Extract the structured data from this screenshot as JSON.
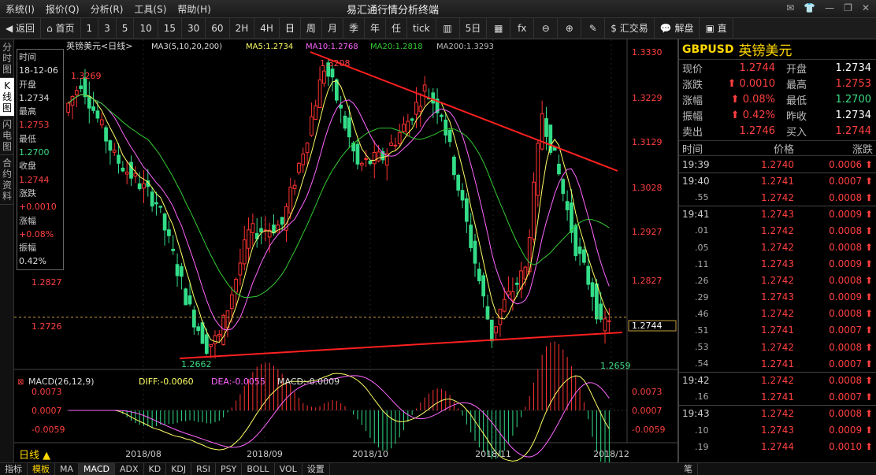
{
  "menu": {
    "items": [
      "系统(I)",
      "报价(Q)",
      "分析(R)",
      "工具(S)",
      "帮助(H)"
    ],
    "title": "易汇通行情分析终端"
  },
  "toolbar": {
    "back": "返回",
    "home": "首页",
    "periods": [
      "1",
      "3",
      "5",
      "10",
      "15",
      "30",
      "60",
      "2H",
      "4H",
      "日",
      "周",
      "月",
      "季",
      "年",
      "任",
      "tick"
    ],
    "five_day": "5日",
    "fx": "fx",
    "trade": "汇交易",
    "unlock": "解盘",
    "last": "直"
  },
  "leftnav": [
    "分时图",
    "K线图",
    "闪电图",
    "合约资料"
  ],
  "chart": {
    "symbol_label": "英镑美元<日线>",
    "ma_label": "MA3(5,10,20,200)",
    "ma5": "MA5:1.2734",
    "ma10": "MA10:1.2768",
    "ma20": "MA20:1.2818",
    "ma200": "MA200:1.3293",
    "price_ticks": [
      "1.3330",
      "1.3229",
      "1.3129",
      "1.3028",
      "1.2927",
      "1.2827",
      "1.2726"
    ],
    "left_ticks": [
      "1.2827",
      "1.2726"
    ],
    "current_price": "1.2744",
    "annotations": {
      "high1": "1.3269",
      "high2": "1.3208",
      "low1": "1.2662",
      "low2": "1.2659"
    },
    "dates": [
      "2018/08",
      "2018/09",
      "2018/10",
      "2018/11",
      "2018/12"
    ],
    "macd_label": "MACD(26,12,9)",
    "diff": "DIFF:-0.0060",
    "dea": "DEA:-0.0055",
    "macd": "MACD:-0.0009",
    "macd_ticks": [
      "0.0073",
      "0.0007",
      "-0.0059"
    ],
    "period_name": "日线"
  },
  "infobox": {
    "time_label": "时间",
    "time": "18-12-06",
    "open_label": "开盘",
    "open": "1.2734",
    "high_label": "最高",
    "high": "1.2753",
    "low_label": "最低",
    "low": "1.2700",
    "close_label": "收盘",
    "close": "1.2744",
    "chg_label": "涨跌",
    "chg": "+0.0010",
    "pct_label": "涨幅",
    "pct": "+0.08%",
    "amp_label": "振幅",
    "amp": "0.42%"
  },
  "quote": {
    "code": "GBPUSD",
    "name": "英镑美元",
    "rows": [
      {
        "l": "现价",
        "v": "1.2744",
        "l2": "开盘",
        "v2": "1.2734",
        "c2": "#ffffff"
      },
      {
        "l": "涨跌",
        "v": "0.0010",
        "l2": "最高",
        "v2": "1.2753",
        "c2": "#ff4040"
      },
      {
        "l": "涨幅",
        "v": "0.08%",
        "l2": "最低",
        "v2": "1.2700",
        "c2": "#3ddc84"
      },
      {
        "l": "振幅",
        "v": "0.42%",
        "l2": "昨收",
        "v2": "1.2734",
        "c2": "#ffffff"
      },
      {
        "l": "卖出",
        "v": "1.2746",
        "l2": "买入",
        "v2": "1.2744",
        "c2": "#ff4040"
      }
    ],
    "tick_headers": [
      "时间",
      "价格",
      "涨跌"
    ],
    "ticks": [
      {
        "t": "19:39",
        "p": "1.2740",
        "c": "0.0006"
      },
      {
        "t": "19:40",
        "p": "1.2741",
        "c": "0.0007"
      },
      {
        "t": ".55",
        "p": "1.2742",
        "c": "0.0008"
      },
      {
        "t": "19:41",
        "p": "1.2743",
        "c": "0.0009"
      },
      {
        "t": ".01",
        "p": "1.2742",
        "c": "0.0008"
      },
      {
        "t": ".05",
        "p": "1.2742",
        "c": "0.0008"
      },
      {
        "t": ".11",
        "p": "1.2743",
        "c": "0.0009"
      },
      {
        "t": ".26",
        "p": "1.2742",
        "c": "0.0008"
      },
      {
        "t": ".29",
        "p": "1.2743",
        "c": "0.0009"
      },
      {
        "t": ".46",
        "p": "1.2742",
        "c": "0.0008"
      },
      {
        "t": ".51",
        "p": "1.2741",
        "c": "0.0007"
      },
      {
        "t": ".53",
        "p": "1.2742",
        "c": "0.0008"
      },
      {
        "t": ".54",
        "p": "1.2741",
        "c": "0.0007"
      },
      {
        "t": "19:42",
        "p": "1.2742",
        "c": "0.0008"
      },
      {
        "t": ".16",
        "p": "1.2741",
        "c": "0.0007"
      },
      {
        "t": "19:43",
        "p": "1.2742",
        "c": "0.0008"
      },
      {
        "t": ".10",
        "p": "1.2743",
        "c": "0.0009"
      },
      {
        "t": ".19",
        "p": "1.2744",
        "c": "0.0010"
      }
    ]
  },
  "bottom": {
    "items": [
      "指标",
      "模板",
      "MA",
      "MACD",
      "ADX",
      "KD",
      "KDJ",
      "RSI",
      "PSY",
      "BOLL",
      "VOL",
      "设置"
    ],
    "right": "笔"
  },
  "colors": {
    "up": "#ff3333",
    "down": "#33dd88",
    "ma5": "#ffff66",
    "ma10": "#ff66ff",
    "ma20": "#33cc33",
    "trend": "#ff2020"
  }
}
